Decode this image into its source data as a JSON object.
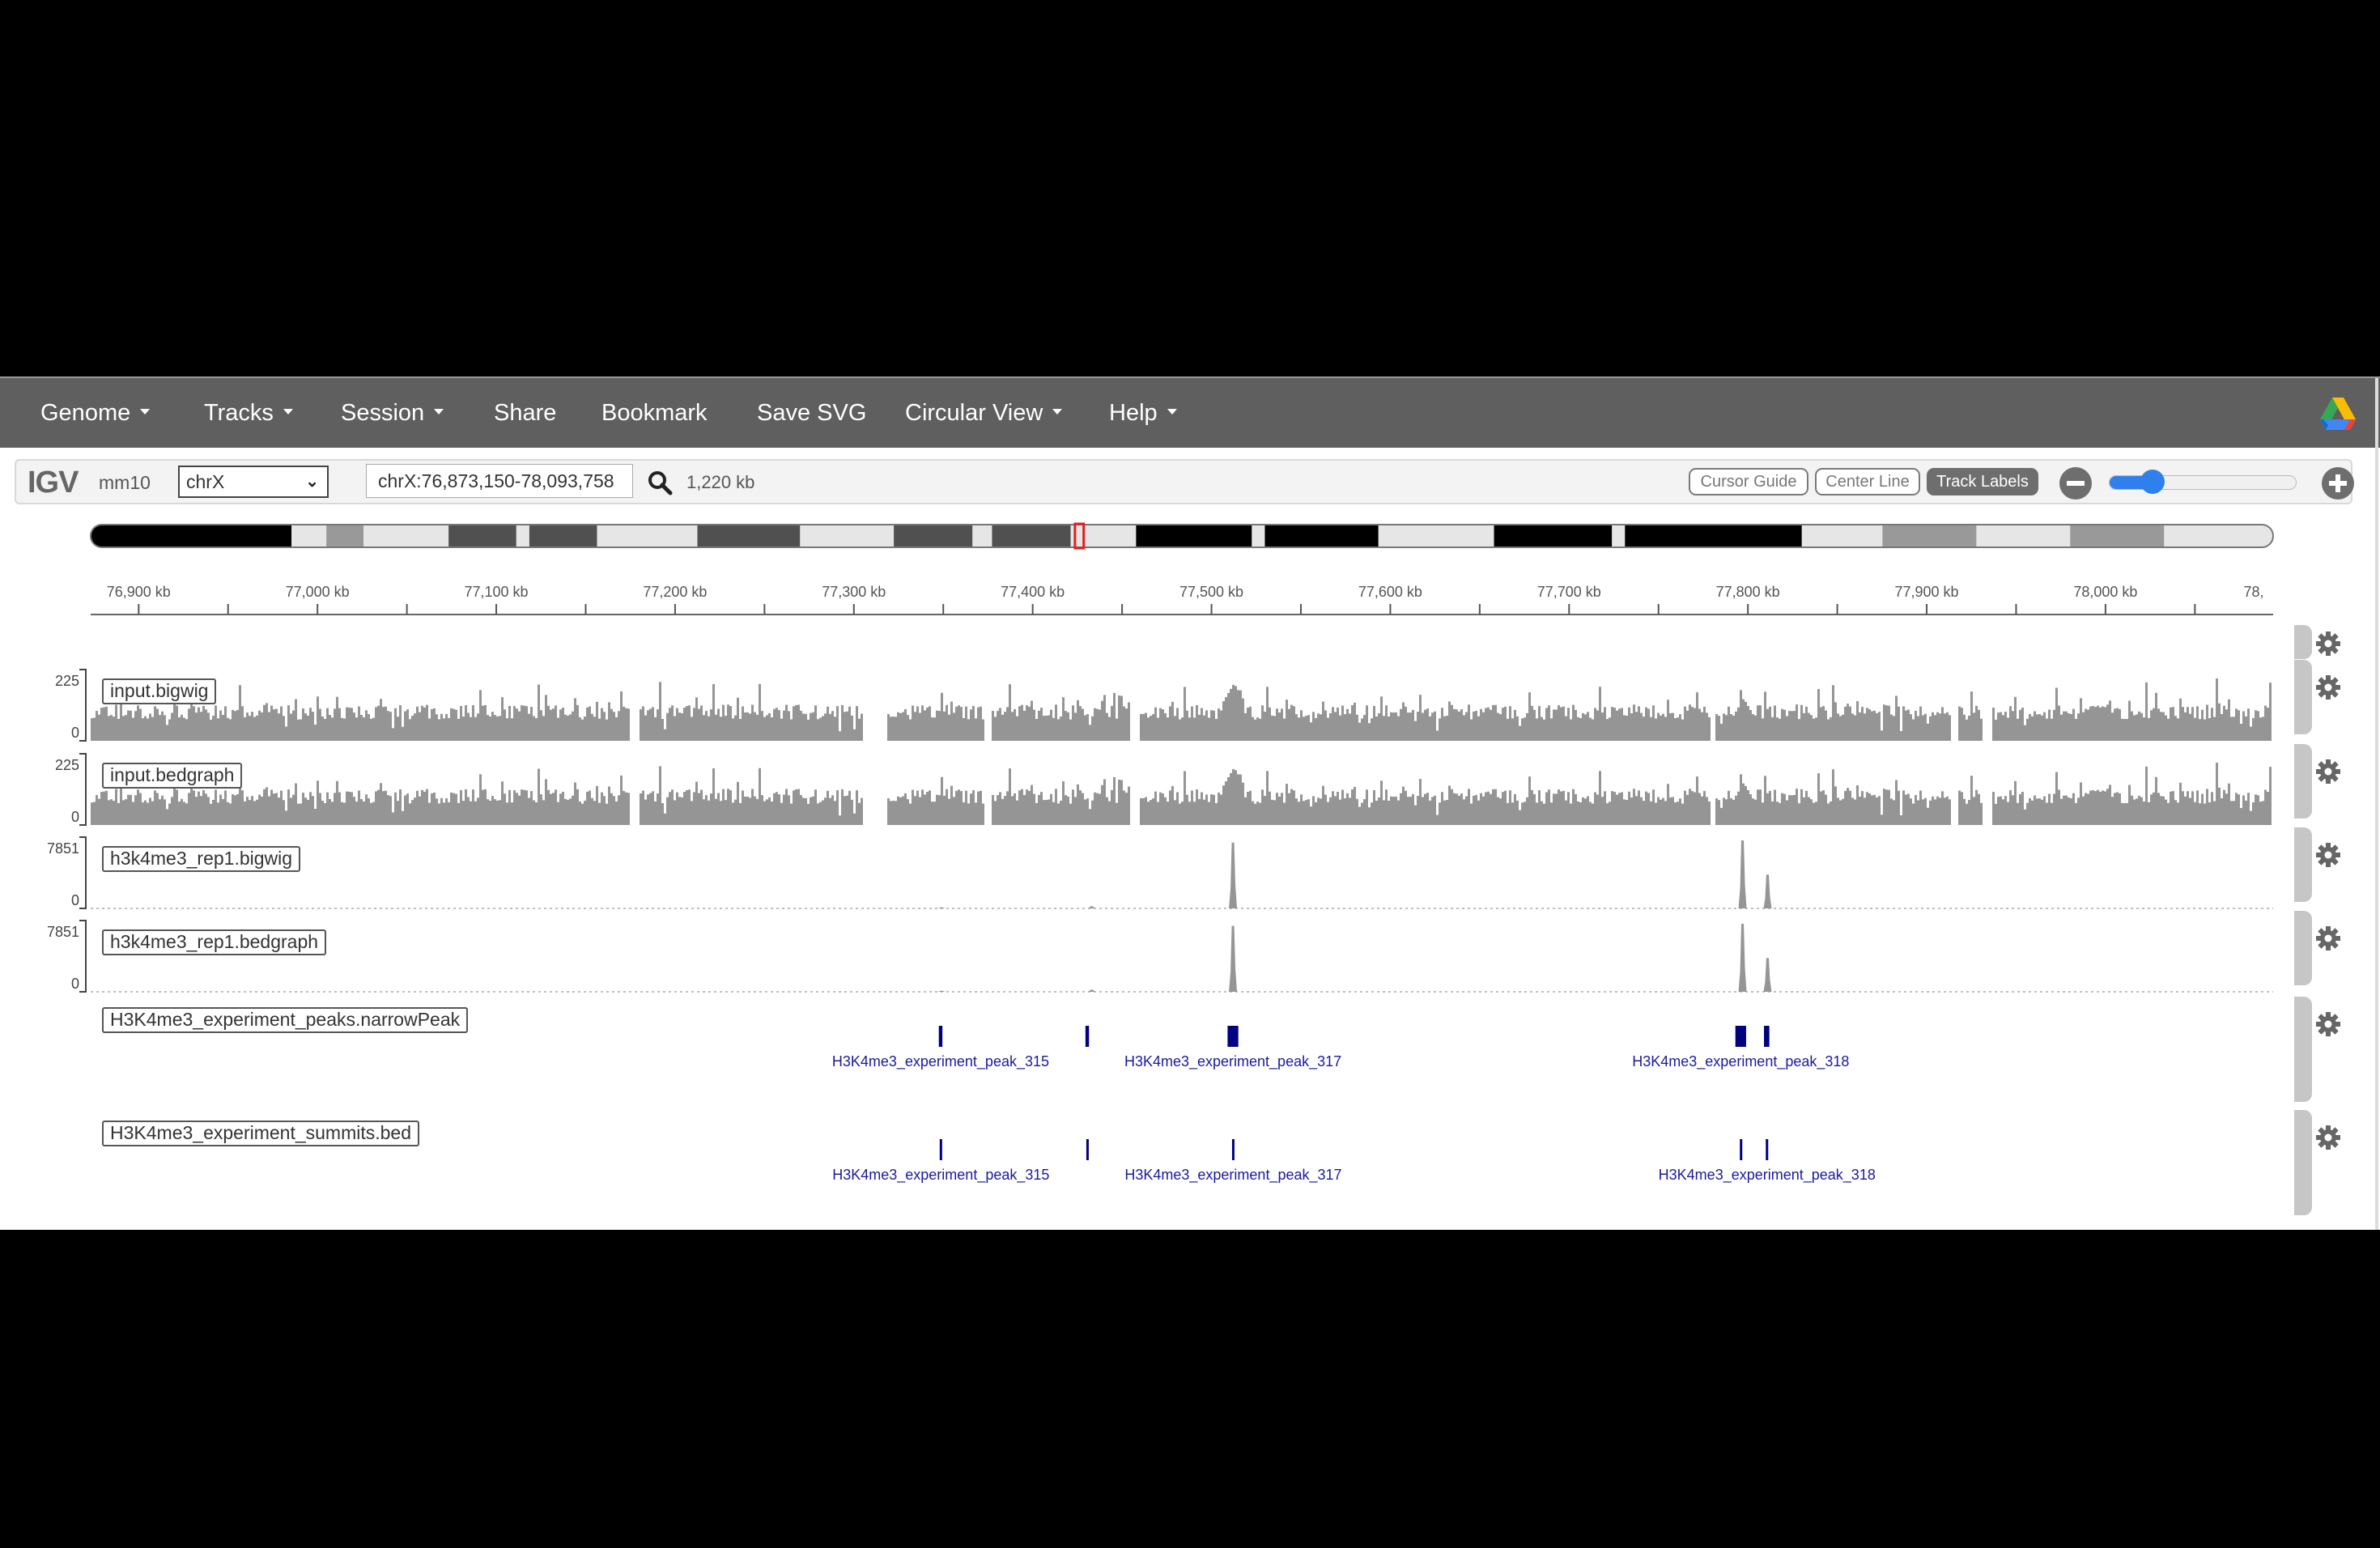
{
  "navbar": {
    "items": [
      {
        "label": "Genome",
        "dropdown": true
      },
      {
        "label": "Tracks",
        "dropdown": true
      },
      {
        "label": "Session",
        "dropdown": true
      },
      {
        "label": "Share",
        "dropdown": false
      },
      {
        "label": "Bookmark",
        "dropdown": false
      },
      {
        "label": "Save SVG",
        "dropdown": false
      },
      {
        "label": "Circular View",
        "dropdown": true
      },
      {
        "label": "Help",
        "dropdown": true
      }
    ],
    "right_icon": "google-drive-icon"
  },
  "toolbar": {
    "logo": "IGV",
    "genome": "mm10",
    "chromosome": "chrX",
    "locus": "chrX:76,873,150-78,093,758",
    "window_size": "1,220 kb",
    "search_icon": "search-icon",
    "buttons": [
      {
        "label": "Cursor Guide",
        "active": false
      },
      {
        "label": "Center Line",
        "active": false
      },
      {
        "label": "Track Labels",
        "active": true
      }
    ],
    "zoom_out_icon": "zoom-out-icon",
    "zoom_in_icon": "zoom-in-icon",
    "zoom_level_fraction": 0.18
  },
  "locus": {
    "chr": "chrX",
    "start": 76873150,
    "end": 78093758
  },
  "ideogram": {
    "bands_fraction": [
      [
        0.0,
        0.092,
        "#000000"
      ],
      [
        0.092,
        0.108,
        "#e6e6e6"
      ],
      [
        0.108,
        0.125,
        "#999999"
      ],
      [
        0.125,
        0.164,
        "#e6e6e6"
      ],
      [
        0.164,
        0.195,
        "#505050"
      ],
      [
        0.195,
        0.201,
        "#e6e6e6"
      ],
      [
        0.201,
        0.232,
        "#505050"
      ],
      [
        0.232,
        0.278,
        "#e6e6e6"
      ],
      [
        0.278,
        0.325,
        "#505050"
      ],
      [
        0.325,
        0.368,
        "#e6e6e6"
      ],
      [
        0.368,
        0.404,
        "#505050"
      ],
      [
        0.404,
        0.413,
        "#e6e6e6"
      ],
      [
        0.413,
        0.449,
        "#505050"
      ],
      [
        0.449,
        0.479,
        "#e6e6e6"
      ],
      [
        0.479,
        0.532,
        "#000000"
      ],
      [
        0.532,
        0.538,
        "#e6e6e6"
      ],
      [
        0.538,
        0.59,
        "#000000"
      ],
      [
        0.59,
        0.643,
        "#e6e6e6"
      ],
      [
        0.643,
        0.697,
        "#000000"
      ],
      [
        0.697,
        0.703,
        "#e6e6e6"
      ],
      [
        0.703,
        0.784,
        "#000000"
      ],
      [
        0.784,
        0.821,
        "#e6e6e6"
      ],
      [
        0.821,
        0.864,
        "#999999"
      ],
      [
        0.864,
        0.907,
        "#e6e6e6"
      ],
      [
        0.907,
        0.95,
        "#999999"
      ],
      [
        0.95,
        1.0,
        "#e6e6e6"
      ]
    ],
    "view_fraction": [
      0.451,
      0.455
    ],
    "view_color": "#e02020"
  },
  "ruler": {
    "ticks": [
      {
        "pos": 76900000,
        "label": "76,900 kb"
      },
      {
        "pos": 77000000,
        "label": "77,000 kb"
      },
      {
        "pos": 77100000,
        "label": "77,100 kb"
      },
      {
        "pos": 77200000,
        "label": "77,200 kb"
      },
      {
        "pos": 77300000,
        "label": "77,300 kb"
      },
      {
        "pos": 77400000,
        "label": "77,400 kb"
      },
      {
        "pos": 77500000,
        "label": "77,500 kb"
      },
      {
        "pos": 77600000,
        "label": "77,600 kb"
      },
      {
        "pos": 77700000,
        "label": "77,700 kb"
      },
      {
        "pos": 77800000,
        "label": "77,800 kb"
      },
      {
        "pos": 77900000,
        "label": "77,900 kb"
      },
      {
        "pos": 78000000,
        "label": "78,000 kb"
      },
      {
        "pos": 78093758,
        "label": "78,"
      }
    ]
  },
  "tracks": [
    {
      "name": "input.bigwig",
      "type": "wig",
      "min": "0",
      "max": "225",
      "color": "#959595",
      "signal": "input",
      "gaps": [
        [
          77174000,
          77179000
        ],
        [
          77304000,
          77318000
        ],
        [
          77372000,
          77377000
        ],
        [
          77454000,
          77459000
        ],
        [
          77778000,
          77781000
        ],
        [
          77913000,
          77917000
        ],
        [
          77930000,
          77936000
        ]
      ],
      "highlights": [
        [
          77512000,
          190
        ],
        [
          77797000,
          140
        ]
      ]
    },
    {
      "name": "input.bedgraph",
      "type": "wig",
      "min": "0",
      "max": "225",
      "color": "#959595",
      "signal": "input",
      "gaps": [
        [
          77174000,
          77179000
        ],
        [
          77304000,
          77318000
        ],
        [
          77372000,
          77377000
        ],
        [
          77454000,
          77459000
        ],
        [
          77778000,
          77781000
        ],
        [
          77913000,
          77917000
        ],
        [
          77930000,
          77936000
        ]
      ],
      "highlights": [
        [
          77512000,
          190
        ],
        [
          77797000,
          140
        ]
      ]
    },
    {
      "name": "h3k4me3_rep1.bigwig",
      "type": "wig",
      "min": "0",
      "max": "7851",
      "color": "#959595",
      "signal": "peaks",
      "peaks": [
        [
          77512000,
          7600
        ],
        [
          77797000,
          7851
        ],
        [
          77811000,
          3900
        ],
        [
          77433000,
          250
        ],
        [
          77349000,
          120
        ]
      ]
    },
    {
      "name": "h3k4me3_rep1.bedgraph",
      "type": "wig",
      "min": "0",
      "max": "7851",
      "color": "#959595",
      "signal": "peaks",
      "peaks": [
        [
          77512000,
          7600
        ],
        [
          77797000,
          7851
        ],
        [
          77811000,
          3900
        ],
        [
          77433000,
          250
        ],
        [
          77349000,
          120
        ]
      ]
    },
    {
      "name": "H3K4me3_experiment_peaks.narrowPeak",
      "type": "feature",
      "color": "#000080",
      "features": [
        {
          "start": 77347500,
          "end": 77349500,
          "label": "H3K4me3_experiment_peak_315"
        },
        {
          "start": 77429500,
          "end": 77431500,
          "label": ""
        },
        {
          "start": 77509000,
          "end": 77515000,
          "label": "H3K4me3_experiment_peak_317"
        },
        {
          "start": 77793000,
          "end": 77799000,
          "label": "H3K4me3_experiment_peak_318"
        },
        {
          "start": 77809000,
          "end": 77812000,
          "label": ""
        }
      ]
    },
    {
      "name": "H3K4me3_experiment_summits.bed",
      "type": "feature",
      "color": "#000080",
      "features": [
        {
          "start": 77348000,
          "end": 77349000,
          "label": "H3K4me3_experiment_peak_315"
        },
        {
          "start": 77430000,
          "end": 77431000,
          "label": ""
        },
        {
          "start": 77511500,
          "end": 77512500,
          "label": "H3K4me3_experiment_peak_317"
        },
        {
          "start": 77795500,
          "end": 77796500,
          "label": ""
        },
        {
          "start": 77810000,
          "end": 77811000,
          "label": "H3K4me3_experiment_peak_318"
        }
      ]
    }
  ]
}
